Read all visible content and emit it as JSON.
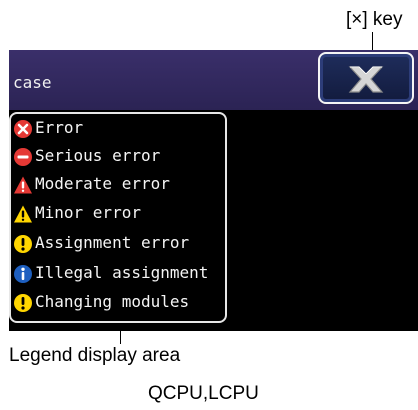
{
  "callouts": {
    "key": "[×] key",
    "legend": "Legend display area",
    "caption": "QCPU,LCPU"
  },
  "screen": {
    "title": "case",
    "close_key": "close-icon"
  },
  "legend": {
    "items": [
      {
        "label": "Error",
        "icon": "error-icon",
        "color": "#e53935"
      },
      {
        "label": "Serious error",
        "icon": "serious-error-icon",
        "color": "#e53935"
      },
      {
        "label": "Moderate error",
        "icon": "moderate-error-icon",
        "color": "#e53935"
      },
      {
        "label": "Minor error",
        "icon": "minor-error-icon",
        "color": "#ffd600"
      },
      {
        "label": "Assignment error",
        "icon": "assignment-error-icon",
        "color": "#ffd600"
      },
      {
        "label": "Illegal assignment",
        "icon": "illegal-assignment-icon",
        "color": "#1e5fbf"
      },
      {
        "label": "Changing modules",
        "icon": "changing-modules-icon",
        "color": "#ffd600"
      }
    ]
  }
}
